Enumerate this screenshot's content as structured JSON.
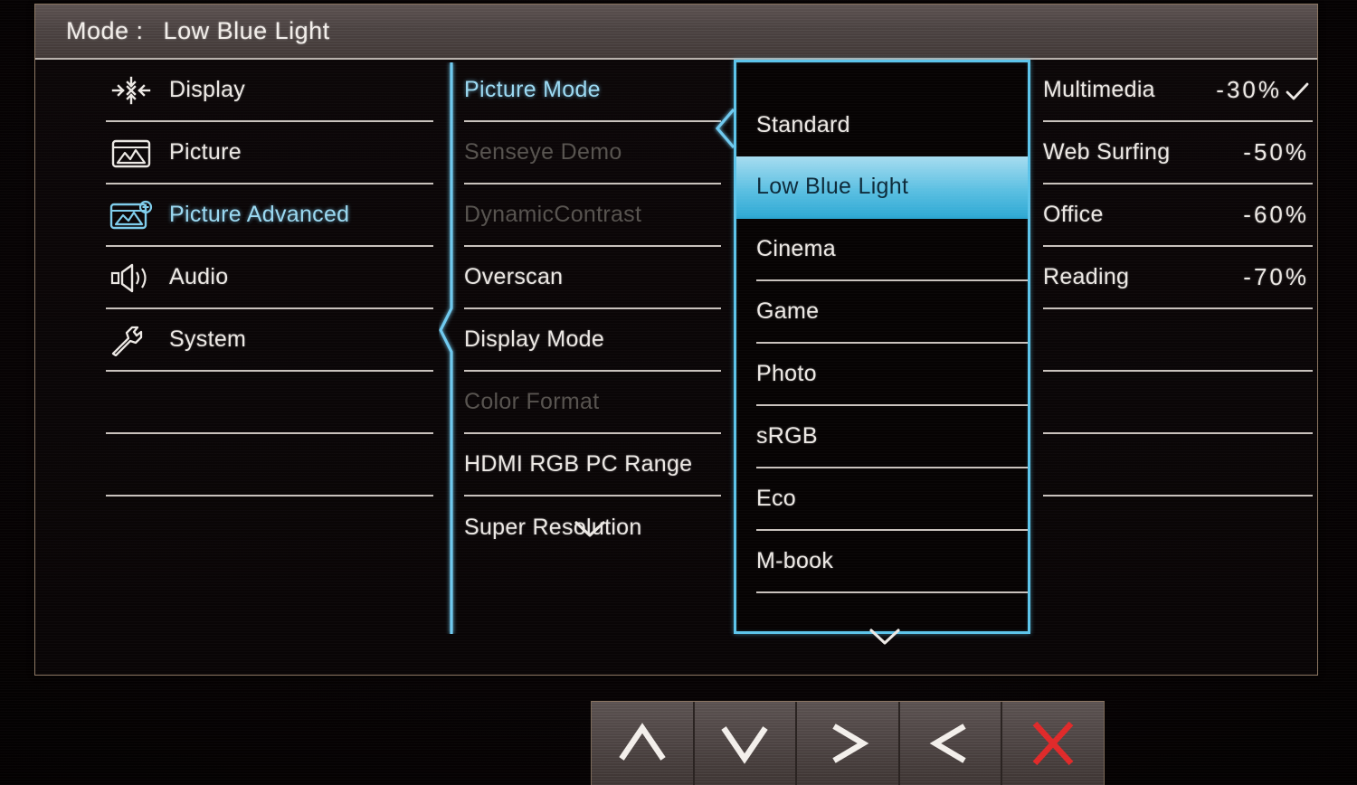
{
  "header": {
    "mode_label": "Mode :",
    "mode_value": "Low Blue Light"
  },
  "categories": {
    "items": [
      {
        "label": "Display",
        "icon": "arrows-in-icon",
        "state": "normal"
      },
      {
        "label": "Picture",
        "icon": "picture-icon",
        "state": "normal"
      },
      {
        "label": "Picture Advanced",
        "icon": "picture-advanced-icon",
        "state": "active"
      },
      {
        "label": "Audio",
        "icon": "speaker-icon",
        "state": "normal"
      },
      {
        "label": "System",
        "icon": "wrench-icon",
        "state": "normal"
      }
    ]
  },
  "settings": {
    "items": [
      {
        "label": "Picture Mode",
        "state": "active"
      },
      {
        "label": "Senseye Demo",
        "state": "disabled"
      },
      {
        "label": "DynamicContrast",
        "state": "disabled"
      },
      {
        "label": "Overscan",
        "state": "normal"
      },
      {
        "label": "Display Mode",
        "state": "normal"
      },
      {
        "label": "Color Format",
        "state": "disabled"
      },
      {
        "label": "HDMI RGB PC Range",
        "state": "normal"
      },
      {
        "label": "Super Resolution",
        "state": "normal"
      }
    ],
    "scroll_down_icon": "chevron-down-icon"
  },
  "values": {
    "items": [
      {
        "label": "Standard",
        "state": "normal"
      },
      {
        "label": "Low Blue Light",
        "state": "selected"
      },
      {
        "label": "Cinema",
        "state": "normal"
      },
      {
        "label": "Game",
        "state": "normal"
      },
      {
        "label": "Photo",
        "state": "normal"
      },
      {
        "label": "sRGB",
        "state": "normal"
      },
      {
        "label": "Eco",
        "state": "normal"
      },
      {
        "label": "M-book",
        "state": "normal"
      }
    ],
    "scroll_down_icon": "chevron-down-icon"
  },
  "presets": {
    "items": [
      {
        "label": "Multimedia",
        "value": "-30%",
        "checked": true
      },
      {
        "label": "Web Surfing",
        "value": "-50%",
        "checked": false
      },
      {
        "label": "Office",
        "value": "-60%",
        "checked": false
      },
      {
        "label": "Reading",
        "value": "-70%",
        "checked": false
      }
    ],
    "check_icon": "check-icon"
  },
  "keybar": {
    "keys": [
      {
        "name": "up-key",
        "icon": "chevron-up-icon",
        "glyph": "∧",
        "color": "#f3efeb"
      },
      {
        "name": "down-key",
        "icon": "chevron-down-icon",
        "glyph": "∨",
        "color": "#f3efeb"
      },
      {
        "name": "right-key",
        "icon": "chevron-right-icon",
        "glyph": ">",
        "color": "#f3efeb"
      },
      {
        "name": "left-key",
        "icon": "chevron-left-icon",
        "glyph": "<",
        "color": "#f3efeb"
      },
      {
        "name": "exit-key",
        "icon": "close-x-icon",
        "glyph": "✕",
        "color": "#e02b2b"
      }
    ]
  },
  "colors": {
    "accent_cyan": "#5cc4ea",
    "highlight_top": "#a6dcf0",
    "highlight_bottom": "#2fa9d4",
    "text": "#ece8e4",
    "dim_text": "#57534f",
    "exit_red": "#e02b2b",
    "panel_border": "#8d7763"
  }
}
